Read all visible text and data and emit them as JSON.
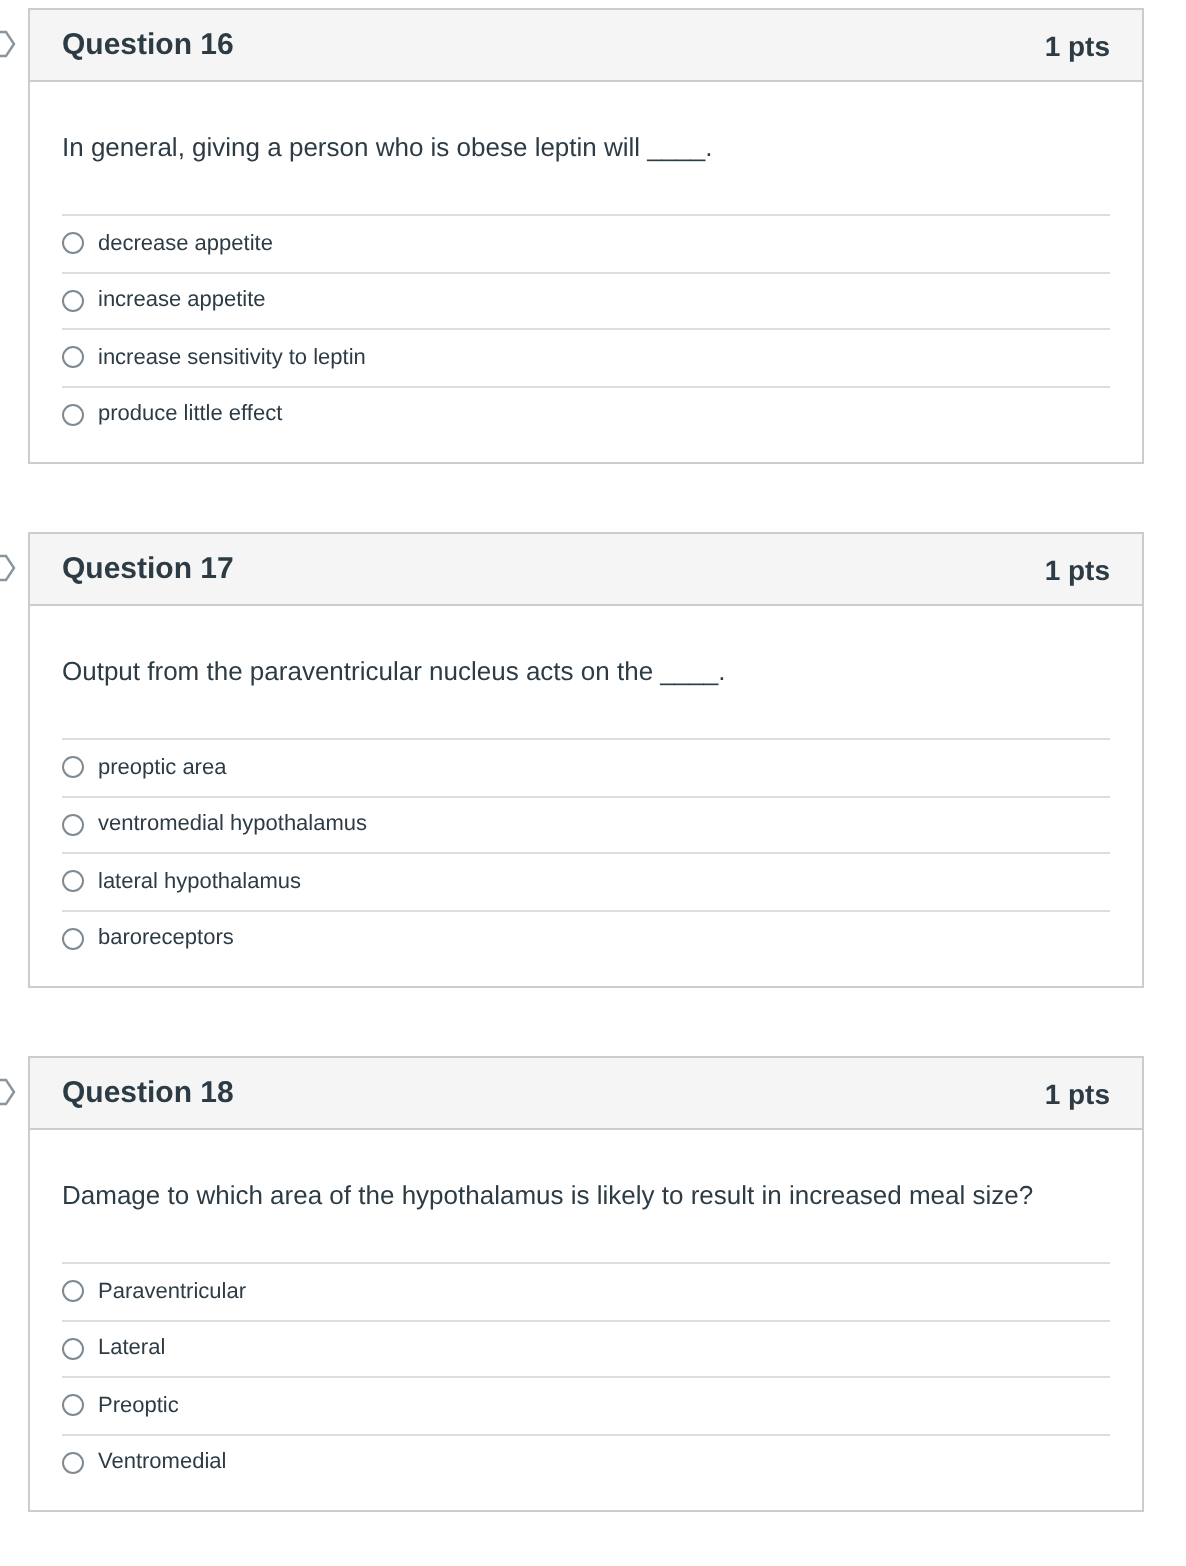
{
  "questions": [
    {
      "title": "Question 16",
      "points": "1 pts",
      "prompt": "In general, giving a person who is obese leptin will ____.",
      "answers": [
        {
          "label": "decrease appetite",
          "selected": false
        },
        {
          "label": "increase appetite",
          "selected": false
        },
        {
          "label": "increase sensitivity to leptin",
          "selected": false
        },
        {
          "label": "produce little effect",
          "selected": false
        }
      ]
    },
    {
      "title": "Question 17",
      "points": "1 pts",
      "prompt": "Output from the paraventricular nucleus acts on the ____.",
      "answers": [
        {
          "label": "preoptic area",
          "selected": false
        },
        {
          "label": "ventromedial hypothalamus",
          "selected": false
        },
        {
          "label": "lateral hypothalamus",
          "selected": false
        },
        {
          "label": "baroreceptors",
          "selected": false
        }
      ]
    },
    {
      "title": "Question 18",
      "points": "1 pts",
      "prompt": "Damage to which area of the hypothalamus is likely to result in increased meal size?",
      "answers": [
        {
          "label": "Paraventricular",
          "selected": false
        },
        {
          "label": "Lateral",
          "selected": false
        },
        {
          "label": "Preoptic",
          "selected": false
        },
        {
          "label": "Ventromedial",
          "selected": false
        }
      ]
    }
  ]
}
